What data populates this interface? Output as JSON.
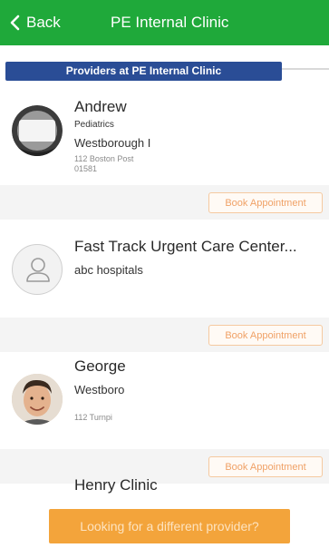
{
  "header": {
    "back_label": "Back",
    "title": "PE Internal Clinic"
  },
  "section": {
    "title": "Providers at PE Internal Clinic"
  },
  "providers": [
    {
      "name": "Andrew",
      "specialty": "Pediatrics",
      "location": "Westborough I",
      "address_line1": "112 Boston Post",
      "address_line2": "01581",
      "book_label": "Book Appointment"
    },
    {
      "name": "Fast Track Urgent Care Center...",
      "location": "abc hospitals",
      "book_label": "Book Appointment"
    },
    {
      "name": "George",
      "location": "Westboro",
      "address_line1": "112 Turnpi",
      "book_label": "Book Appointment"
    },
    {
      "name": "Henry Clinic"
    }
  ],
  "cta": {
    "label": "Looking for a different provider?"
  },
  "colors": {
    "header_bg": "#1fa93a",
    "section_bg": "#2a4d96",
    "cta_bg": "#f3a43b",
    "book_text": "#f0a166"
  }
}
